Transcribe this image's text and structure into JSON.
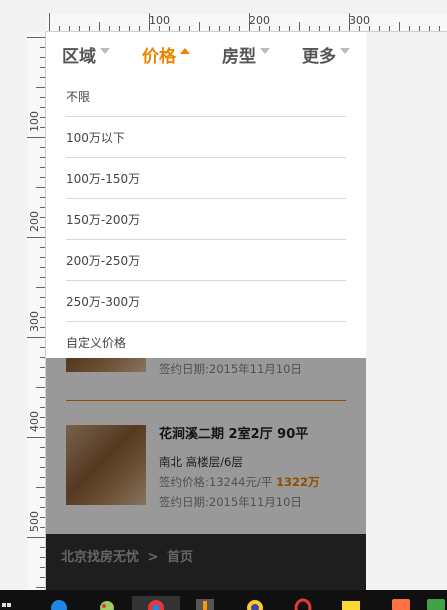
{
  "ruler": {
    "h_labels": [
      "100",
      "200",
      "300"
    ],
    "v_labels": [
      "100",
      "200",
      "300",
      "400",
      "500"
    ]
  },
  "filters": [
    {
      "label": "区域",
      "active": false
    },
    {
      "label": "价格",
      "active": true
    },
    {
      "label": "房型",
      "active": false
    },
    {
      "label": "更多",
      "active": false
    }
  ],
  "price_options": [
    "不限",
    "100万以下",
    "100万-150万",
    "150万-200万",
    "200万-250万",
    "250万-300万",
    "自定义价格"
  ],
  "listings": [
    {
      "title": "",
      "layout": "",
      "unit_price": "",
      "total": "",
      "date": "签约日期:2015年11月10日"
    },
    {
      "title": "花涧溪二期 2室2厅 90平",
      "layout": "南北 高楼层/6层",
      "unit_price": "签约价格:13244元/平",
      "total": "1322万",
      "date": "签约日期:2015年11月10日"
    }
  ],
  "breadcrumb": {
    "site": "北京找房无忧",
    "sep": ">",
    "page": "首页"
  },
  "colors": {
    "accent": "#f08300",
    "footer": "#333333",
    "overlay": "rgba(0,0,0,0.4)"
  }
}
